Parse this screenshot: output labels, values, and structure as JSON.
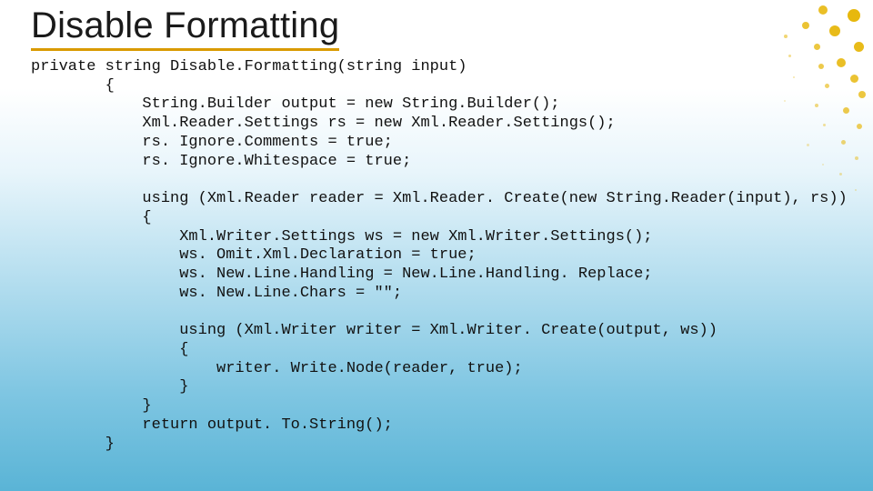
{
  "slide": {
    "title": "Disable Formatting",
    "code": "private string Disable.Formatting(string input)\n        {\n            String.Builder output = new String.Builder();\n            Xml.Reader.Settings rs = new Xml.Reader.Settings();\n            rs. Ignore.Comments = true;\n            rs. Ignore.Whitespace = true;\n\n            using (Xml.Reader reader = Xml.Reader. Create(new String.Reader(input), rs))\n            {\n                Xml.Writer.Settings ws = new Xml.Writer.Settings();\n                ws. Omit.Xml.Declaration = true;\n                ws. New.Line.Handling = New.Line.Handling. Replace;\n                ws. New.Line.Chars = \"\";\n\n                using (Xml.Writer writer = Xml.Writer. Create(output, ws))\n                {\n                    writer. Write.Node(reader, true);\n                }\n            }\n            return output. To.String();\n        }"
  }
}
